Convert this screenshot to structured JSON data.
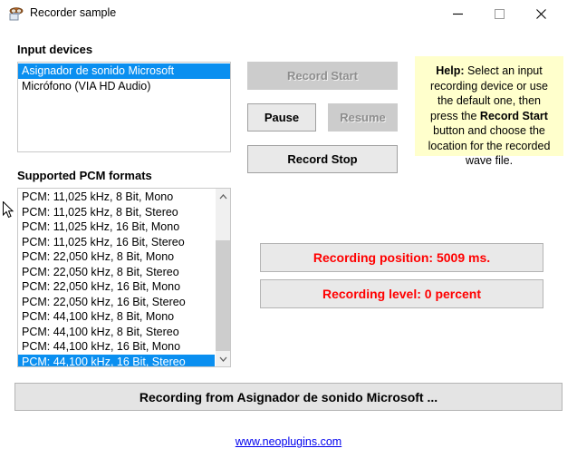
{
  "window": {
    "title": "Recorder sample",
    "icon": "recorder-icon",
    "controls": {
      "minimize": "minimize-icon",
      "maximize": "maximize-icon",
      "close": "close-icon"
    }
  },
  "input_devices": {
    "label": "Input devices",
    "items": [
      {
        "text": "Asignador de sonido Microsoft",
        "selected": true
      },
      {
        "text": "Micrófono (VIA HD Audio)",
        "selected": false
      }
    ]
  },
  "pcm_formats": {
    "label": "Supported PCM formats",
    "items": [
      {
        "text": "PCM: 11,025 kHz, 8 Bit, Mono",
        "selected": false
      },
      {
        "text": "PCM: 11,025 kHz, 8 Bit, Stereo",
        "selected": false
      },
      {
        "text": "PCM: 11,025 kHz, 16 Bit, Mono",
        "selected": false
      },
      {
        "text": "PCM: 11,025 kHz, 16 Bit, Stereo",
        "selected": false
      },
      {
        "text": "PCM: 22,050 kHz, 8 Bit, Mono",
        "selected": false
      },
      {
        "text": "PCM: 22,050 kHz, 8 Bit, Stereo",
        "selected": false
      },
      {
        "text": "PCM: 22,050 kHz, 16 Bit, Mono",
        "selected": false
      },
      {
        "text": "PCM: 22,050 kHz, 16 Bit, Stereo",
        "selected": false
      },
      {
        "text": "PCM: 44,100 kHz, 8 Bit, Mono",
        "selected": false
      },
      {
        "text": "PCM: 44,100 kHz, 8 Bit, Stereo",
        "selected": false
      },
      {
        "text": "PCM: 44,100 kHz, 16 Bit, Mono",
        "selected": false
      },
      {
        "text": "PCM: 44,100 kHz, 16 Bit, Stereo",
        "selected": true
      }
    ],
    "scrollbar": {
      "up_icon": "chevron-up-icon",
      "down_icon": "chevron-down-icon"
    }
  },
  "buttons": {
    "record_start": {
      "label": "Record Start",
      "enabled": false
    },
    "pause": {
      "label": "Pause",
      "enabled": true
    },
    "resume": {
      "label": "Resume",
      "enabled": false
    },
    "record_stop": {
      "label": "Record Stop",
      "enabled": true
    }
  },
  "help": {
    "title": "Help:",
    "text_before": " Select an input recording device or use the default one, then press the ",
    "emphasis": "Record Start",
    "text_after": " button and choose the location for the recorded wave file."
  },
  "readouts": {
    "position": "Recording position: 5009 ms.",
    "level": "Recording level: 0 percent"
  },
  "status_bar": "Recording from Asignador de sonido Microsoft ...",
  "link": "www.neoplugins.com",
  "colors": {
    "selection_blue": "#0a8ff0",
    "help_yellow": "#ffffcc",
    "readout_red": "#ff0000",
    "link_blue": "#0000ee",
    "button_face": "#e9e9e9",
    "button_disabled": "#cccccc"
  }
}
